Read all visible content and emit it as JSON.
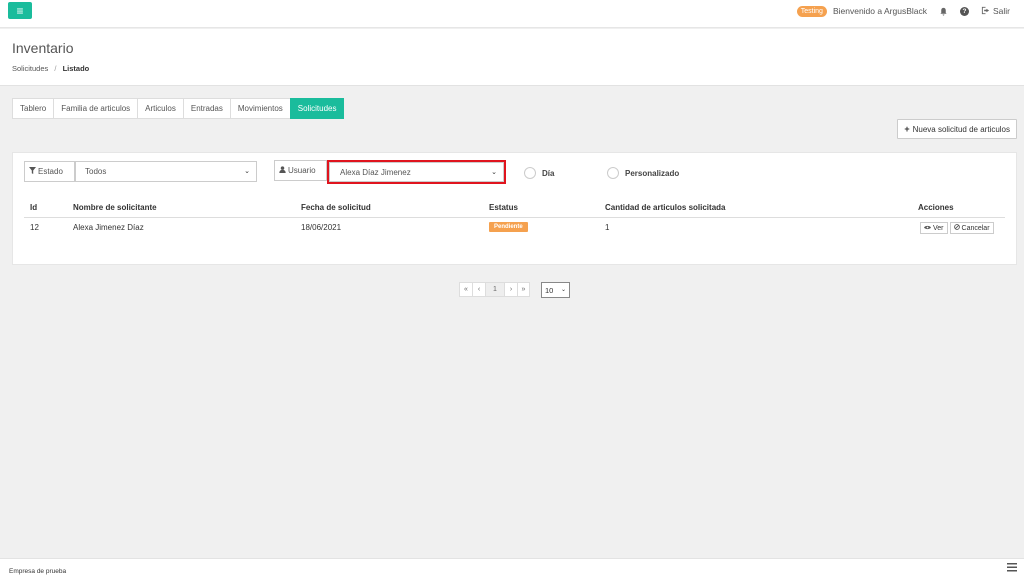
{
  "topbar": {
    "env_badge": "Testing",
    "welcome": "Bienvenido a ArgusBlack",
    "logout_label": "Salir"
  },
  "header": {
    "title": "Inventario",
    "breadcrumb": [
      "Solicitudes",
      "Listado"
    ]
  },
  "tabs": [
    {
      "label": "Tablero",
      "active": false
    },
    {
      "label": "Familia de articulos",
      "active": false
    },
    {
      "label": "Articulos",
      "active": false
    },
    {
      "label": "Entradas",
      "active": false
    },
    {
      "label": "Movimientos",
      "active": false
    },
    {
      "label": "Solicitudes",
      "active": true
    }
  ],
  "new_request_label": "Nueva solicitud de articulos",
  "filters": {
    "estado_label": "Estado",
    "estado_value": "Todos",
    "usuario_label": "Usuario",
    "usuario_value": "Alexa Díaz Jimenez",
    "radio_dia": "Día",
    "radio_personalizado": "Personalizado"
  },
  "table": {
    "columns": [
      "Id",
      "Nombre de solicitante",
      "Fecha de solicitud",
      "Estatus",
      "Cantidad de articulos solicitada",
      "Acciones"
    ],
    "rows": [
      {
        "id": "12",
        "nombre": "Alexa Jimenez Díaz",
        "fecha": "18/06/2021",
        "estatus": "Pendiente",
        "cantidad": "1",
        "ver": "Ver",
        "cancelar": "Cancelar"
      }
    ]
  },
  "pagination": {
    "first": "«",
    "prev": "‹",
    "current": "1",
    "next": "›",
    "last": "»",
    "per_page": "10"
  },
  "footer": {
    "company": "Empresa de prueba"
  },
  "colors": {
    "accent": "#1abc9c",
    "warning": "#f5a14f",
    "highlight": "#e0141e"
  }
}
